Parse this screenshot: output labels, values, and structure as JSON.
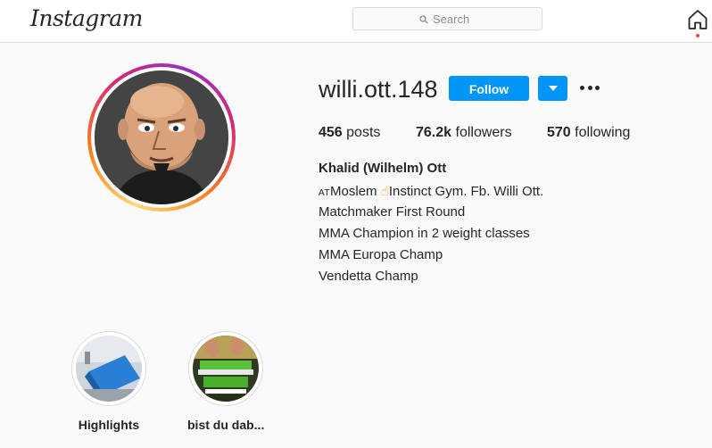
{
  "header": {
    "logo_text": "Instagram",
    "search_placeholder": "Search",
    "home_icon": "home-icon",
    "notification_dot_color": "#ed4956"
  },
  "profile": {
    "username": "willi.ott.148",
    "follow_label": "Follow",
    "accent_color": "#0095f6",
    "stats": {
      "posts_count": "456",
      "posts_label": "posts",
      "followers_count": "76.2k",
      "followers_label": "followers",
      "following_count": "570",
      "following_label": "following"
    },
    "full_name": "Khalid (Wilhelm) Ott",
    "bio": {
      "line1_prefix": "AT",
      "line1_word": "Moslem",
      "line1_emoji": "☝",
      "line1_rest": "Instinct Gym. Fb. Willi Ott.",
      "line2": "Matchmaker First Round",
      "line3": "MMA Champion in 2 weight classes",
      "line4": "MMA Europa Champ",
      "line5": "Vendetta Champ"
    }
  },
  "highlights": [
    {
      "label": "Highlights"
    },
    {
      "label": "bist du dab..."
    }
  ]
}
